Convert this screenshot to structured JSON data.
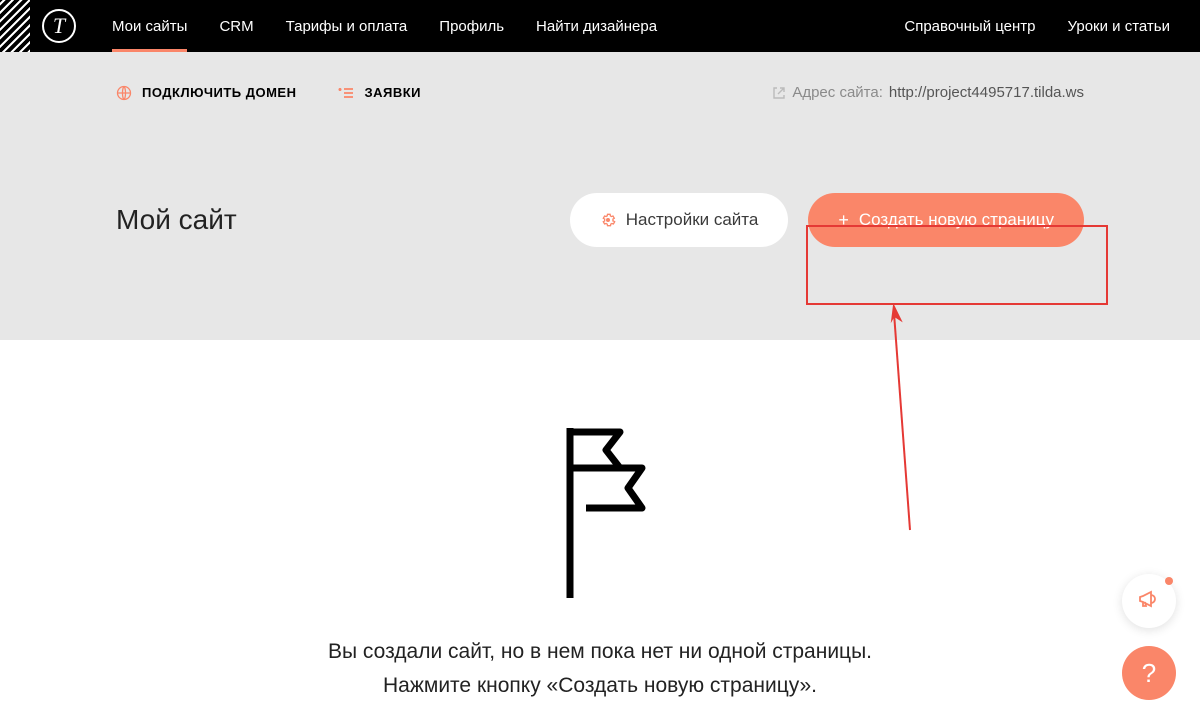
{
  "header": {
    "logo_text": "T",
    "nav": [
      {
        "label": "Мои сайты",
        "active": true
      },
      {
        "label": "CRM",
        "active": false
      },
      {
        "label": "Тарифы и оплата",
        "active": false
      },
      {
        "label": "Профиль",
        "active": false
      },
      {
        "label": "Найти дизайнера",
        "active": false
      }
    ],
    "nav_right": [
      {
        "label": "Справочный центр"
      },
      {
        "label": "Уроки и статьи"
      }
    ]
  },
  "toolbar": {
    "connect_domain": "ПОДКЛЮЧИТЬ ДОМЕН",
    "requests": "ЗАЯВКИ",
    "site_url_label": "Адрес сайта:",
    "site_url_value": "http://project4495717.tilda.ws",
    "site_title": "Мой сайт",
    "settings_label": "Настройки сайта",
    "create_page_label": "Создать новую страницу"
  },
  "empty": {
    "line1": "Вы создали сайт, но в нем пока нет ни одной страницы.",
    "line2": "Нажмите кнопку «Создать новую страницу»."
  },
  "fab": {
    "help": "?"
  }
}
